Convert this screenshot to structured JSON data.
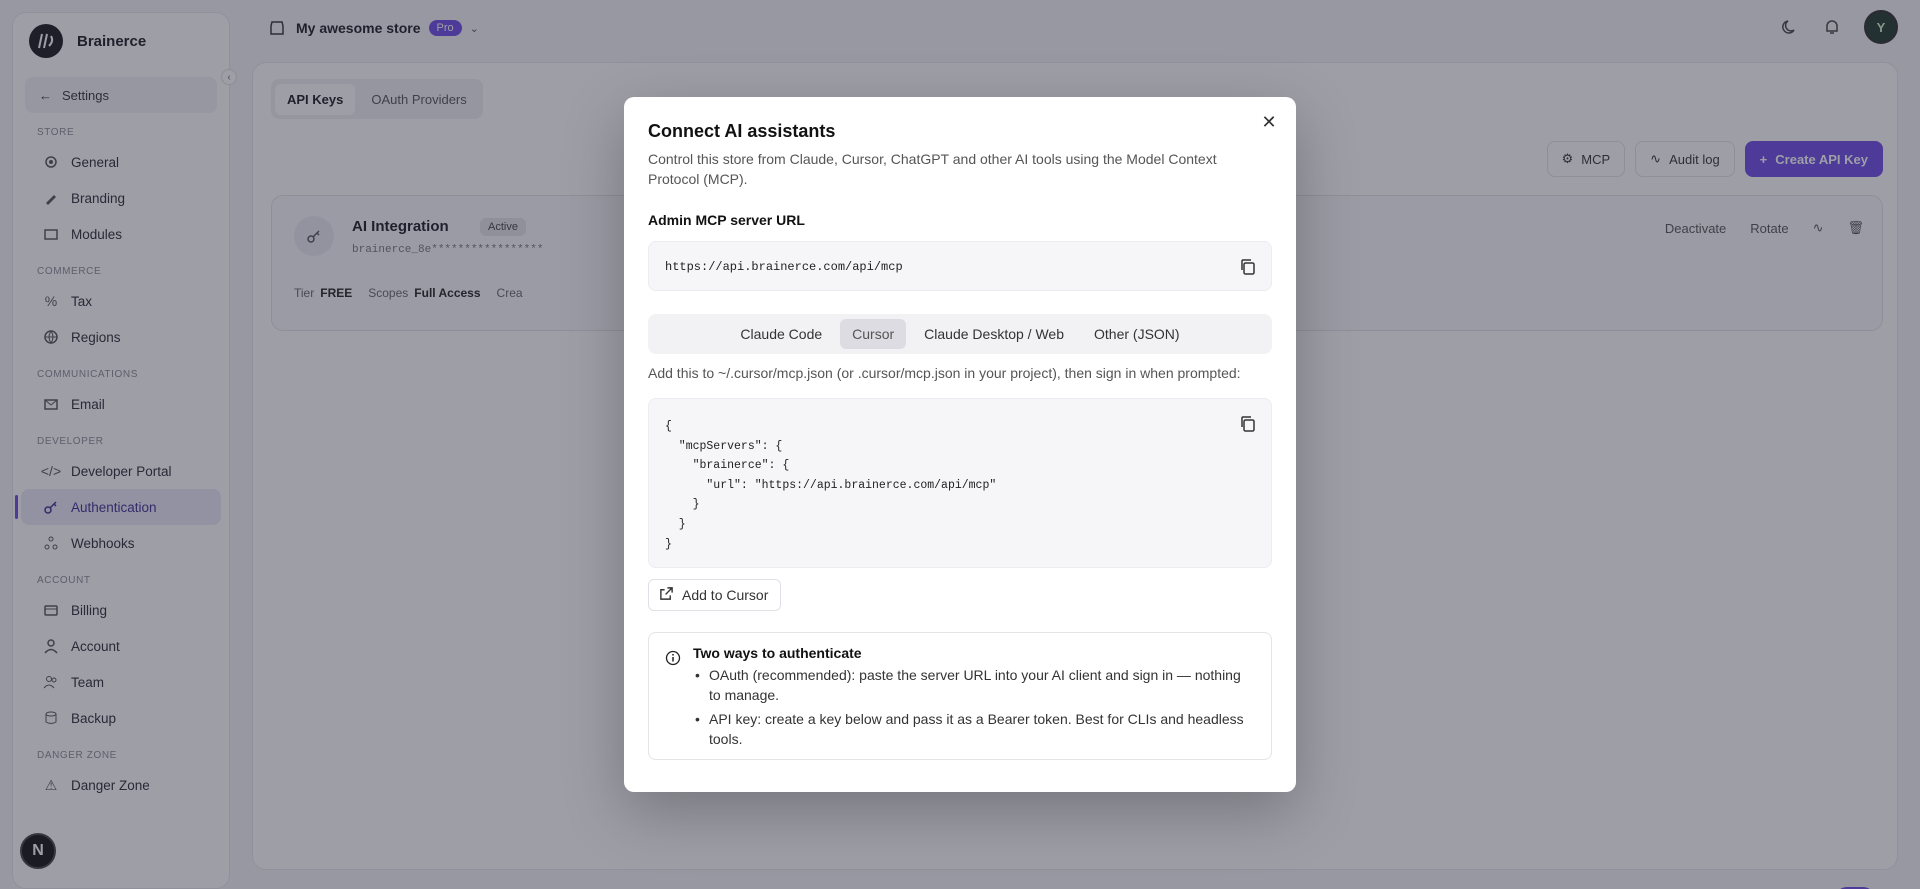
{
  "sidebar": {
    "brand_name": "Brainerce",
    "back_label": "Settings",
    "sections": [
      {
        "label": "Store",
        "items": [
          {
            "label": "General",
            "icon": "gear-icon"
          },
          {
            "label": "Branding",
            "icon": "brush-icon"
          },
          {
            "label": "Modules",
            "icon": "box-icon"
          }
        ]
      },
      {
        "label": "Commerce",
        "items": [
          {
            "label": "Tax",
            "icon": "percent-icon"
          },
          {
            "label": "Regions",
            "icon": "globe-icon"
          }
        ]
      },
      {
        "label": "Communications",
        "items": [
          {
            "label": "Email",
            "icon": "mail-icon"
          }
        ]
      },
      {
        "label": "Developer",
        "items": [
          {
            "label": "Developer Portal",
            "icon": "code-icon"
          },
          {
            "label": "Authentication",
            "icon": "key-icon",
            "active": true
          },
          {
            "label": "Webhooks",
            "icon": "webhook-icon"
          }
        ]
      },
      {
        "label": "Account",
        "items": [
          {
            "label": "Billing",
            "icon": "card-icon"
          },
          {
            "label": "Account",
            "icon": "user-icon"
          },
          {
            "label": "Team",
            "icon": "team-icon"
          },
          {
            "label": "Backup",
            "icon": "database-icon"
          }
        ]
      },
      {
        "label": "Danger Zone",
        "items": [
          {
            "label": "Danger Zone",
            "icon": "warning-icon"
          }
        ]
      }
    ]
  },
  "topbar": {
    "store_name": "My awesome store",
    "plan_badge": "Pro"
  },
  "main": {
    "tabs": [
      {
        "label": "API Keys",
        "selected": true
      },
      {
        "label": "OAuth Providers",
        "selected": false
      }
    ],
    "actions": {
      "mcp": "MCP",
      "audit_log": "Audit log",
      "create": "Create API Key"
    },
    "key_card": {
      "name": "AI Integration",
      "status": "Active",
      "masked_key": "brainerce_8e*****************",
      "tier_label": "Tier",
      "tier_value": "FREE",
      "scopes_label": "Scopes",
      "scopes_value": "Full Access",
      "created_label": "Crea",
      "deactivate": "Deactivate",
      "rotate": "Rotate"
    }
  },
  "modal": {
    "title": "Connect AI assistants",
    "description": "Control this store from Claude, Cursor, ChatGPT and other AI tools using the Model Context Protocol (MCP).",
    "url_label": "Admin MCP server URL",
    "url_value": "https://api.brainerce.com/api/mcp",
    "client_tabs": [
      {
        "label": "Claude Code",
        "selected": false
      },
      {
        "label": "Cursor",
        "selected": true
      },
      {
        "label": "Claude Desktop / Web",
        "selected": false
      },
      {
        "label": "Other (JSON)",
        "selected": false
      }
    ],
    "instructions": "Add this to ~/.cursor/mcp.json (or .cursor/mcp.json in your project), then sign in when prompted:",
    "code_snippet": "{\n  \"mcpServers\": {\n    \"brainerce\": {\n      \"url\": \"https://api.brainerce.com/api/mcp\"\n    }\n  }\n}",
    "add_button": "Add to Cursor",
    "info": {
      "title": "Two ways to authenticate",
      "items": [
        "OAuth (recommended): paste the server URL into your AI client and sign in — nothing to manage.",
        "API key: create a key below and pass it as a Bearer token. Best for CLIs and headless tools."
      ]
    }
  },
  "corner_badge": "N",
  "colors": {
    "accent": "#6d4ae3",
    "overlay": "rgba(40,40,60,0.45)"
  }
}
